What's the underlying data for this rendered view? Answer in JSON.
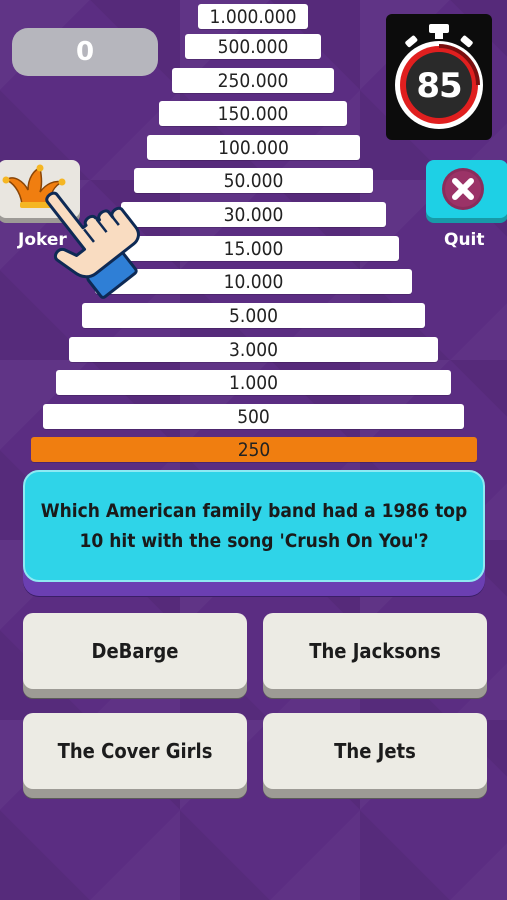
{
  "score": "0",
  "timer": "85",
  "ladder": [
    "1.000.000",
    "500.000",
    "250.000",
    "150.000",
    "100.000",
    "50.000",
    "30.000",
    "15.000",
    "10.000",
    "5.000",
    "3.000",
    "1.000",
    "500",
    "250"
  ],
  "current_prize": "250",
  "joker_label": "Joker",
  "quit_label": "Quit",
  "question": "Which American family band had a 1986 top 10 hit with the song 'Crush On You'?",
  "answers": [
    "DeBarge",
    "The Jacksons",
    "The Cover Girls",
    "The Jets"
  ],
  "colors": {
    "background": "#5b2d82",
    "current_rung": "#f07e10",
    "question_card": "#2fd4e8",
    "quit_button": "#1ed0e5",
    "timer_ring": "#e01f1f"
  },
  "icons": {
    "joker": "jester-hat-icon",
    "quit": "close-x-icon",
    "timer": "stopwatch-icon",
    "hint": "pointing-hand-icon"
  }
}
